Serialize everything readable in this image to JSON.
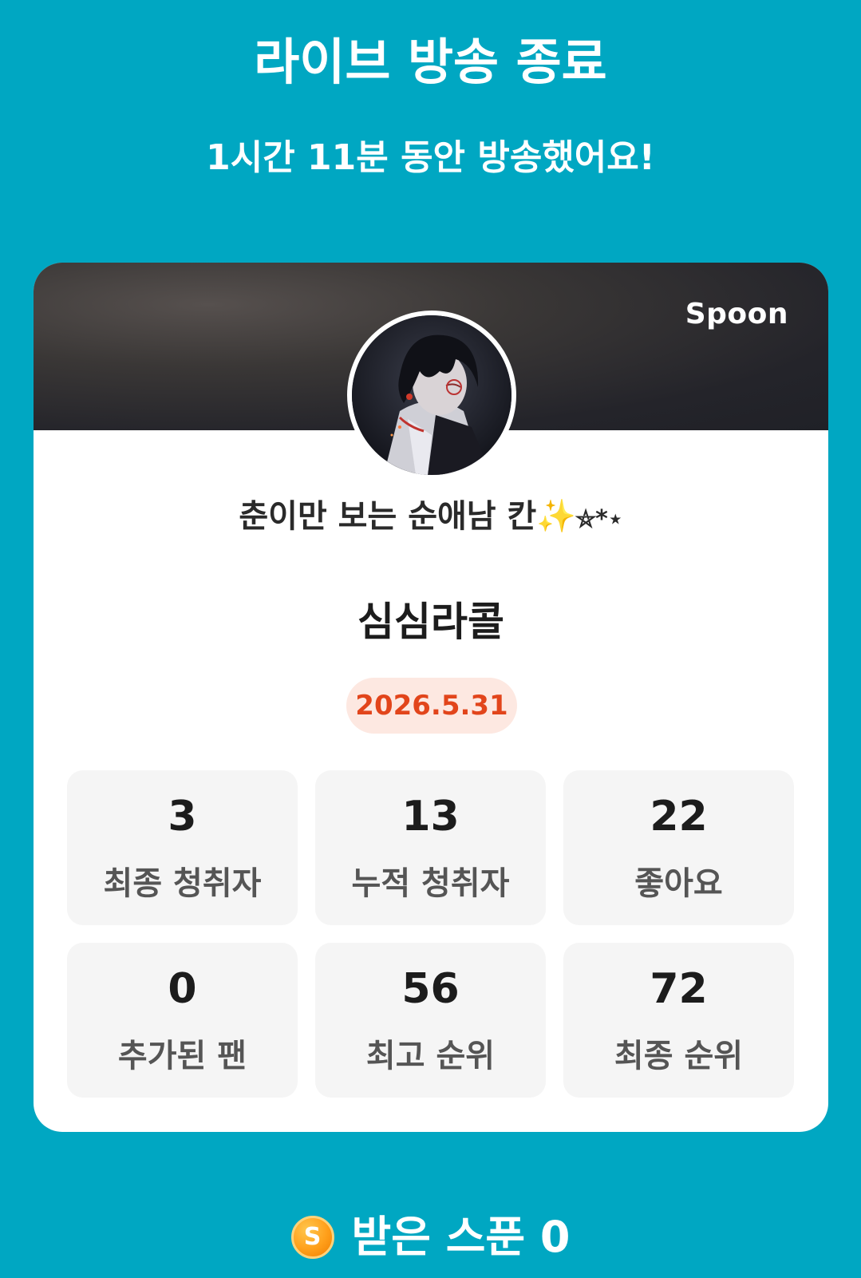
{
  "header": {
    "title": "라이브 방송 종료",
    "subtitle": "1시간 11분 동안 방송했어요!"
  },
  "card": {
    "brand": "Spoon",
    "room_title": "춘이만 보는 순애남 칸",
    "room_title_deco": "✨",
    "room_title_deco2": "⛥*⋆",
    "host_name": "심심라콜",
    "date": "2026.5.31",
    "stats": [
      {
        "value": "3",
        "label": "최종 청취자"
      },
      {
        "value": "13",
        "label": "누적 청취자"
      },
      {
        "value": "22",
        "label": "좋아요"
      },
      {
        "value": "0",
        "label": "추가된 팬"
      },
      {
        "value": "56",
        "label": "최고 순위"
      },
      {
        "value": "72",
        "label": "최종 순위"
      }
    ]
  },
  "footer": {
    "coin_letter": "S",
    "received_label": "받은 스푼 0"
  },
  "colors": {
    "background": "#00a7c2",
    "date_text": "#e2451b",
    "date_badge": "#fde8e1",
    "coin": "#ff9f1a"
  },
  "icons": {
    "coin": "spoon-coin-icon",
    "avatar": "host-avatar"
  }
}
